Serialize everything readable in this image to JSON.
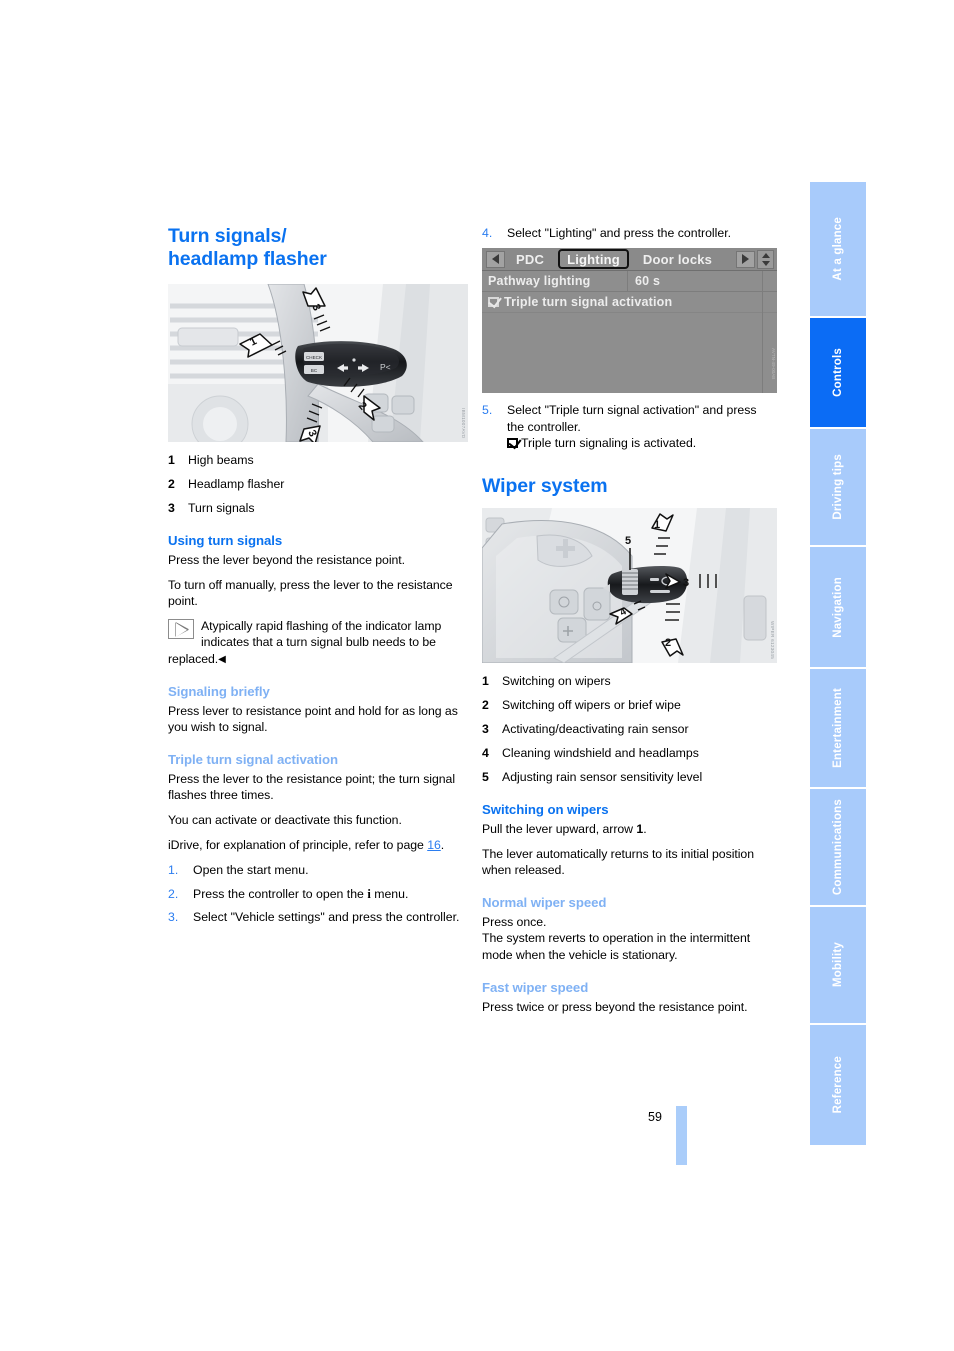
{
  "page": {
    "number": "59"
  },
  "left_column": {
    "heading": "Turn signals/ headlamp flasher",
    "heading_line1": "Turn signals/",
    "heading_line2": "headlamp flasher",
    "figure": {
      "name": "turn-signal-lever-illustration",
      "code": "IBM1007AVD"
    },
    "legend": [
      {
        "num": "1",
        "text": "High beams"
      },
      {
        "num": "2",
        "text": "Headlamp flasher"
      },
      {
        "num": "3",
        "text": "Turn signals"
      }
    ],
    "using_turn_signals": {
      "heading": "Using turn signals",
      "p1": "Press the lever beyond the resistance point.",
      "p2": "To turn off manually, press the lever to the resistance point.",
      "note": "Atypically rapid flashing of the indicator lamp indicates that a turn signal bulb needs to be replaced.",
      "note_endmark": "◀"
    },
    "signaling_briefly": {
      "heading": "Signaling briefly",
      "p1": "Press lever to resistance point and hold for as long as you wish to signal."
    },
    "triple_turn": {
      "heading": "Triple turn signal activation",
      "p1": "Press the lever to the resistance point; the turn signal flashes three times.",
      "p2": "You can activate or deactivate this function.",
      "p3_pre": "iDrive, for explanation of principle, refer to page ",
      "p3_link": "16",
      "p3_post": ".",
      "steps": [
        {
          "num": "1.",
          "text": "Open the start menu."
        },
        {
          "num": "2.",
          "text_pre": "Press the controller to open the ",
          "glyph": "i",
          "text_post": " menu."
        },
        {
          "num": "3.",
          "text": "Select \"Vehicle settings\" and press the controller."
        }
      ]
    }
  },
  "right_column": {
    "step4": {
      "num": "4.",
      "text": "Select \"Lighting\" and press the controller."
    },
    "idrive": {
      "name": "idrive-screen",
      "left_arrow": "◀",
      "right_arrow": "▶",
      "tabs": [
        {
          "label": "PDC",
          "selected": false
        },
        {
          "label": "Lighting",
          "selected": true
        },
        {
          "label": "Door locks",
          "selected": false
        }
      ],
      "rows": [
        {
          "key": "Pathway lighting",
          "value": "60 s"
        }
      ],
      "checkbox_row": {
        "label": "Triple turn signal activation",
        "checked": true
      },
      "code": "AVTN-49-00AB"
    },
    "step5": {
      "num": "5.",
      "text": "Select \"Triple turn signal activation\" and press the controller.",
      "result": "Triple turn signaling is activated."
    },
    "wiper_system": {
      "heading": "Wiper system",
      "figure": {
        "name": "wiper-lever-illustration",
        "code": "WIPER 6123045"
      },
      "legend": [
        {
          "num": "1",
          "text": "Switching on wipers"
        },
        {
          "num": "2",
          "text": "Switching off wipers or brief wipe"
        },
        {
          "num": "3",
          "text": "Activating/deactivating rain sensor"
        },
        {
          "num": "4",
          "text": "Cleaning windshield and headlamps"
        },
        {
          "num": "5",
          "text": "Adjusting rain sensor sensitivity level"
        }
      ],
      "switching_on": {
        "heading": "Switching on wipers",
        "p1_pre": "Pull the lever upward, arrow ",
        "p1_bold": "1",
        "p1_post": ".",
        "p2": "The lever automatically returns to its initial position when released."
      },
      "normal_speed": {
        "heading": "Normal wiper speed",
        "p1": "Press once.",
        "p2": "The system reverts to operation in the intermittent mode when the vehicle is stationary."
      },
      "fast_speed": {
        "heading": "Fast wiper speed",
        "p1": "Press twice or press beyond the resistance point."
      }
    }
  },
  "sidebar": {
    "accent_active": "#0b6cf5",
    "accent_inactive": "#a8cbfb",
    "tabs": [
      {
        "label": "At a glance",
        "active": false
      },
      {
        "label": "Controls",
        "active": true
      },
      {
        "label": "Driving tips",
        "active": false
      },
      {
        "label": "Navigation",
        "active": false
      },
      {
        "label": "Entertainment",
        "active": false
      },
      {
        "label": "Communications",
        "active": false
      },
      {
        "label": "Mobility",
        "active": false
      },
      {
        "label": "Reference",
        "active": false
      }
    ]
  }
}
